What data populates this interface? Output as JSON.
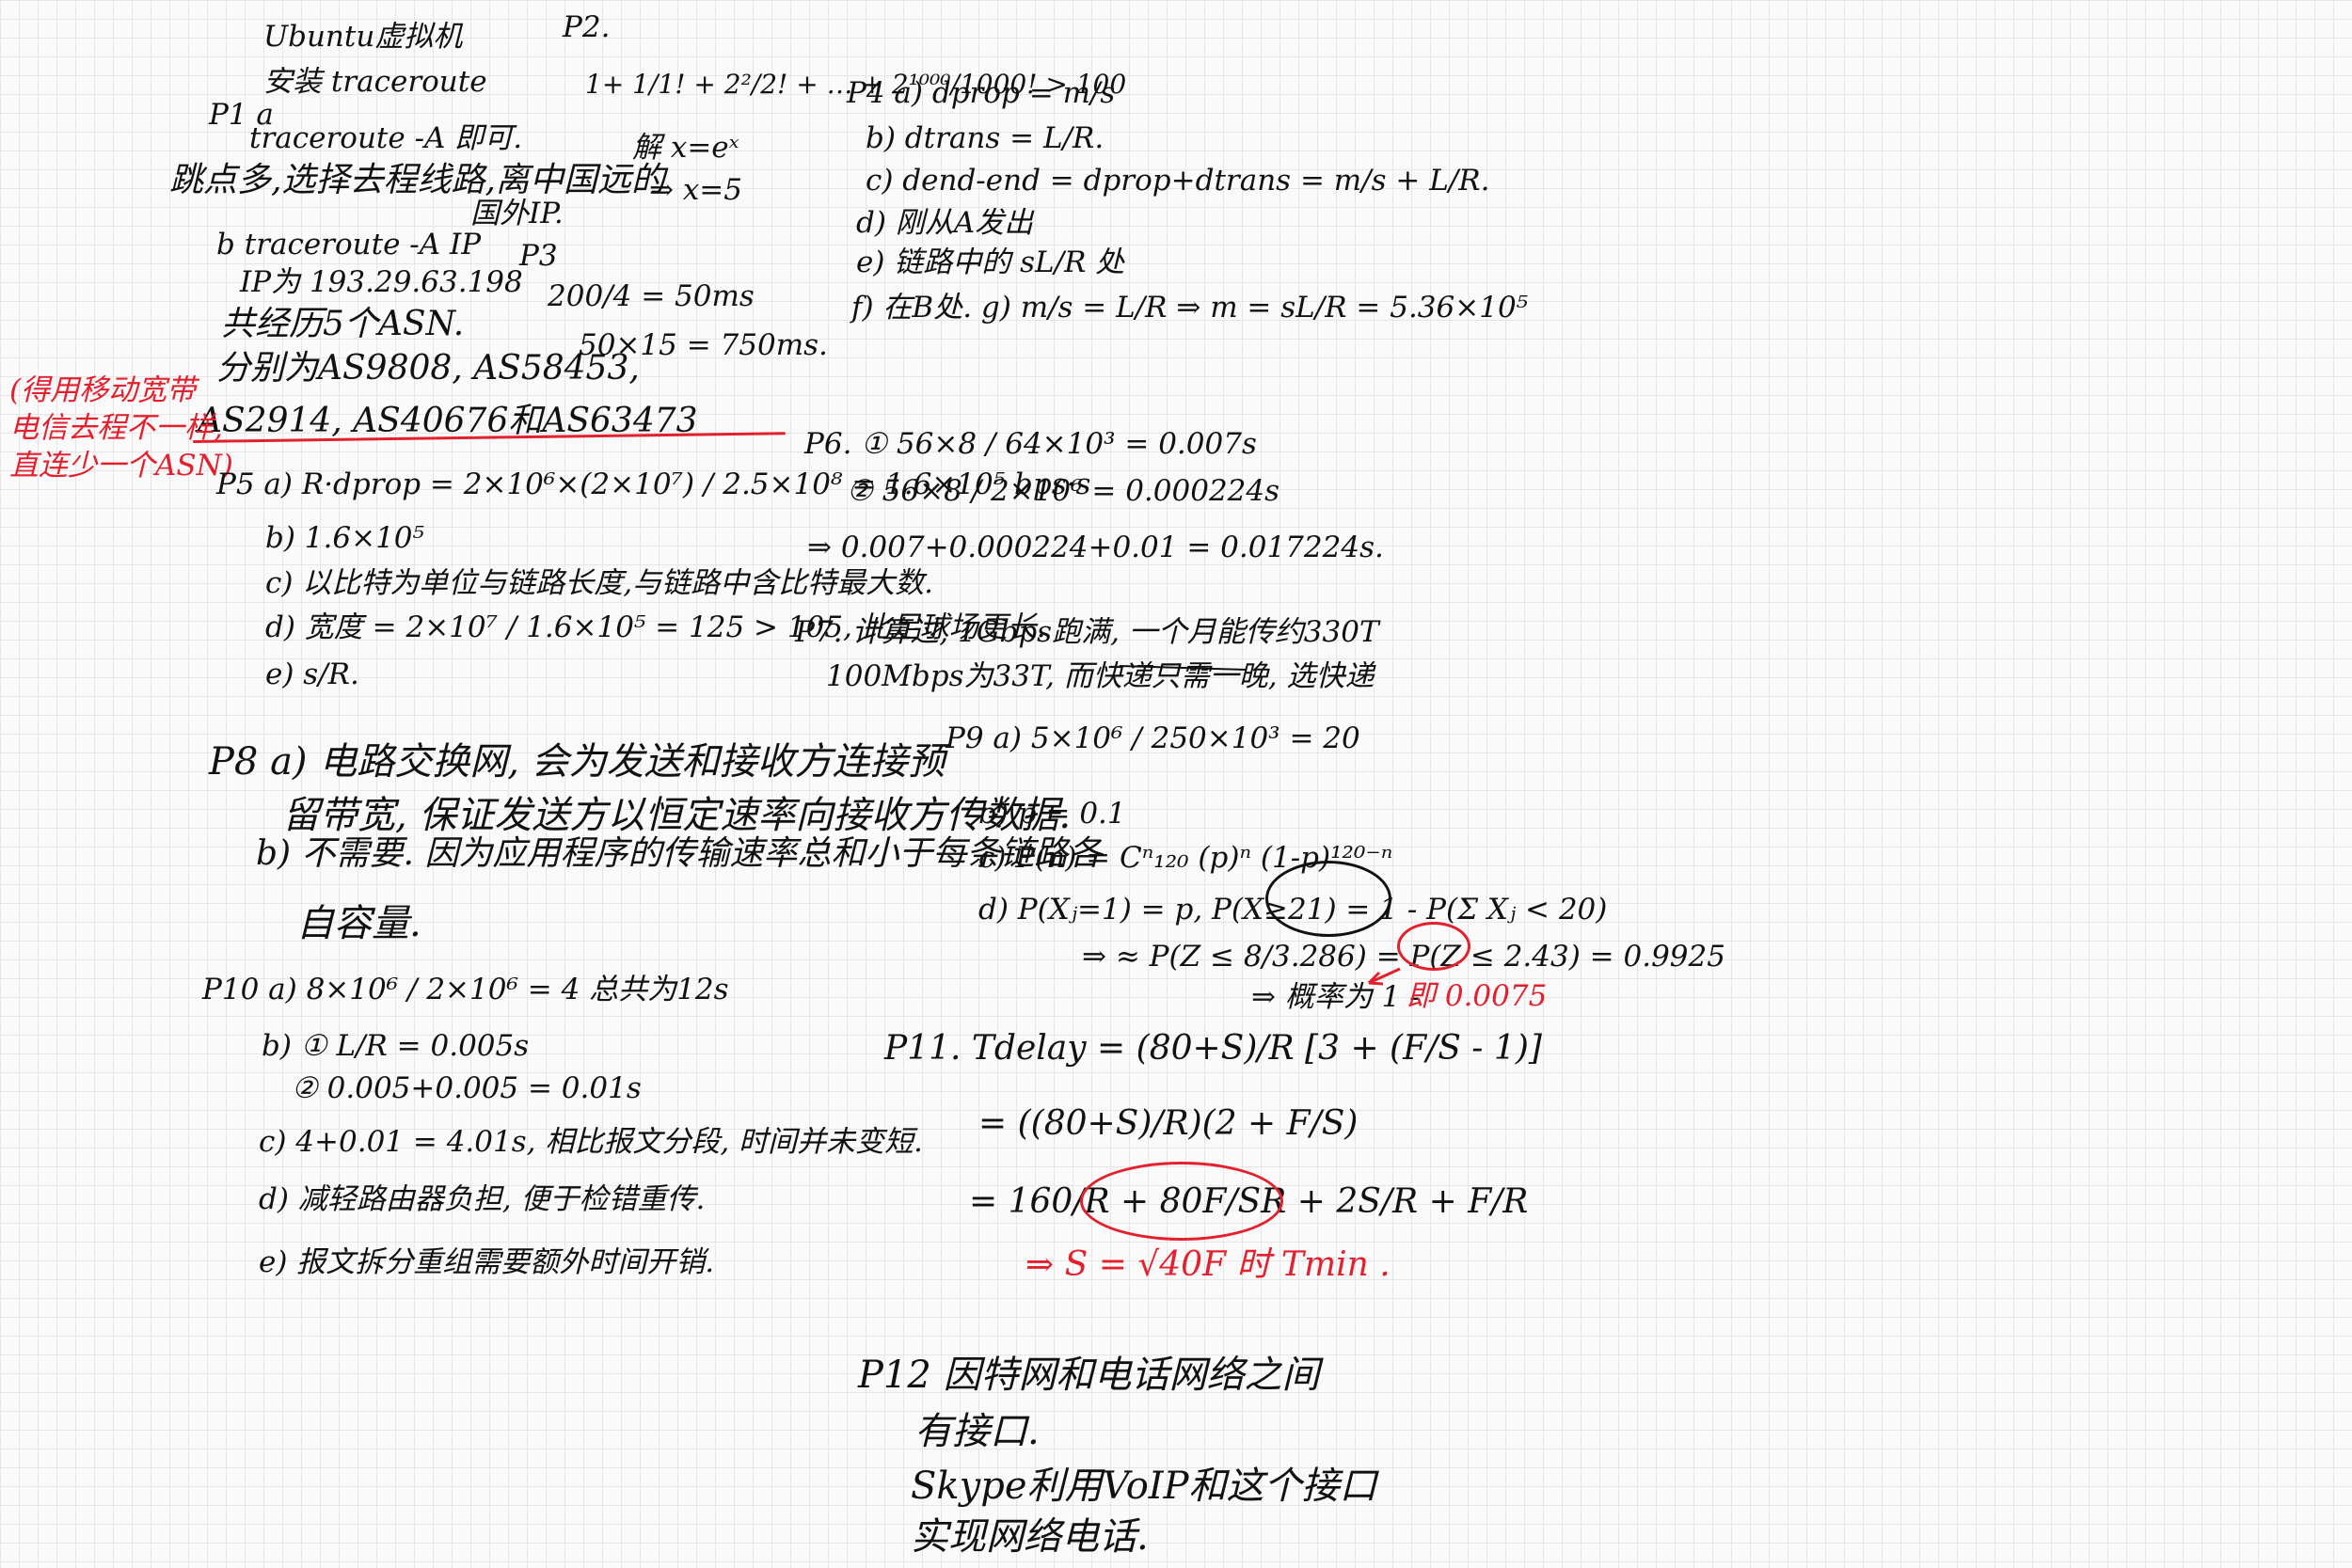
{
  "p1": {
    "lines": [
      "Ubuntu虚拟机",
      "安装 traceroute",
      "P1 a",
      "traceroute -A 即可.",
      "跳点多,选择去程线路,离中国远的",
      "国外IP.",
      "b traceroute -A IP",
      "IP为 193.29.63.198",
      "共经历5个ASN.",
      "分别为AS9808, AS58453,",
      "AS2914, AS40676和AS63473"
    ],
    "note": [
      "(得用移动宽带",
      "电信去程不一样,",
      "直连少一个ASN)"
    ]
  },
  "p2": {
    "lines": [
      "P2.",
      "1+ 1/1! + 2²/2! + … + 2¹⁰⁰⁰/1000! > 100",
      "解 x=eˣ",
      "⇒ x=5"
    ]
  },
  "p3": {
    "lines": [
      "P3",
      "200/4 = 50ms",
      "50×15 = 750ms."
    ]
  },
  "p4": {
    "lines": [
      "P4  a) dprop = m/s",
      "b) dtrans = L/R.",
      "c) dend-end = dprop+dtrans = m/s + L/R.",
      "d) 刚从A发出",
      "e) 链路中的 sL/R 处",
      "f) 在B处.   g) m/s = L/R ⇒ m = sL/R = 5.36×10⁵"
    ]
  },
  "p5": {
    "lines": [
      "P5  a) R·dprop = 2×10⁶×(2×10⁷) / 2.5×10⁸ = 1.6×10⁵ bps·s",
      "b) 1.6×10⁵",
      "c) 以比特为单位与链路长度,与链路中含比特最大数.",
      "d) 宽度 = 2×10⁷ / 1.6×10⁵ = 125 > 105, 比足球场更长.",
      "e) s/R."
    ]
  },
  "p6": {
    "lines": [
      "P6.  ① 56×8 / 64×10³ = 0.007s",
      "② 56×8 / 2×10⁶ = 0.000224s",
      "⇒ 0.007+0.000224+0.01 = 0.017224s."
    ]
  },
  "p7": {
    "lines": [
      "P7. 计算过, 1Gbps跑满, 一个月能传约330T",
      "100Mbps为33T, 而快递只需一晚, 选快递"
    ]
  },
  "p8": {
    "lines": [
      "P8  a) 电路交换网, 会为发送和接收方连接预",
      "留带宽, 保证发送方以恒定速率向接收方传数据.",
      "b) 不需要. 因为应用程序的传输速率总和小于每条链路各",
      "自容量."
    ]
  },
  "p9": {
    "lines": [
      "P9 a) 5×10⁶ / 250×10³ = 20",
      "b) p = 0.1",
      "c) P(n) = Cⁿ₁₂₀ (p)ⁿ (1-p)¹²⁰⁻ⁿ",
      "d) P(Xⱼ=1) = p,   P(X≥21) = 1 - P(Σ Xⱼ < 20)",
      "⇒ ≈ P(Z ≤ 8/3.286) = P(Z ≤ 2.43) = 0.9925",
      "⇒ 概率为 1 -",
      "即 0.0075"
    ]
  },
  "p10": {
    "lines": [
      "P10  a)  8×10⁶ / 2×10⁶ = 4    总共为12s",
      "b) ① L/R = 0.005s",
      "② 0.005+0.005 = 0.01s",
      "c) 4+0.01 = 4.01s, 相比报文分段, 时间并未变短.",
      "d) 减轻路由器负担, 便于检错重传.",
      "e) 报文拆分重组需要额外时间开销."
    ]
  },
  "p11": {
    "lines": [
      "P11. Tdelay = (80+S)/R [3 + (F/S - 1)]",
      "= ((80+S)/R)(2 + F/S)",
      "= 160/R + 80F/SR + 2S/R + F/R",
      "⇒ S = √40F 时 Tmin ."
    ]
  },
  "p12": {
    "lines": [
      "P12  因特网和电话网络之间",
      "有接口.",
      "Skype利用VoIP和这个接口",
      "实现网络电话."
    ]
  }
}
